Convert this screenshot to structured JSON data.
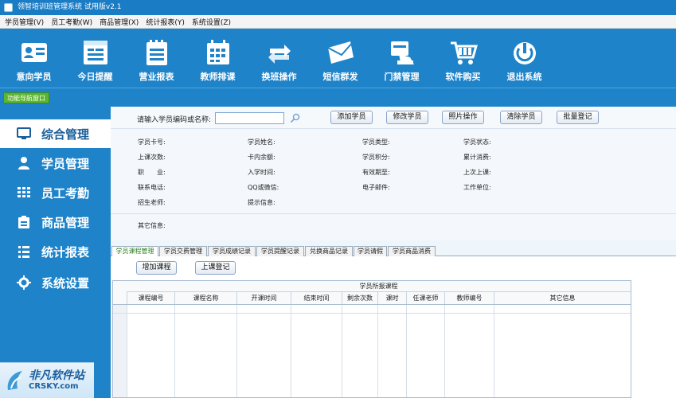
{
  "window": {
    "title": "领智培训班管理系统 试用版v2.1"
  },
  "menu": [
    "学员管理(V)",
    "员工考勤(W)",
    "商品管理(X)",
    "统计报表(Y)",
    "系统设置(Z)"
  ],
  "toolbar": [
    {
      "label": "意向学员",
      "icon": "id-card-icon"
    },
    {
      "label": "今日提醒",
      "icon": "document-icon"
    },
    {
      "label": "营业报表",
      "icon": "report-icon"
    },
    {
      "label": "教师排课",
      "icon": "calendar-icon"
    },
    {
      "label": "换班操作",
      "icon": "swap-arrows-icon"
    },
    {
      "label": "短信群发",
      "icon": "envelope-icon"
    },
    {
      "label": "门禁管理",
      "icon": "card-swipe-icon"
    },
    {
      "label": "软件购买",
      "icon": "cart-icon"
    },
    {
      "label": "退出系统",
      "icon": "power-icon"
    }
  ],
  "nav_window_label": "功能导航窗口",
  "sidebar": [
    {
      "label": "综合管理",
      "icon": "monitor-icon",
      "active": true
    },
    {
      "label": "学员管理",
      "icon": "user-icon"
    },
    {
      "label": "员工考勤",
      "icon": "grid-icon"
    },
    {
      "label": "商品管理",
      "icon": "clipboard-icon"
    },
    {
      "label": "统计报表",
      "icon": "list-icon"
    },
    {
      "label": "系统设置",
      "icon": "gear-icon"
    }
  ],
  "search": {
    "label": "请输入学员编码或名称:",
    "value": ""
  },
  "actions": [
    "添加学员",
    "修改学员",
    "照片操作",
    "清除学员",
    "批量登记"
  ],
  "info_fields": [
    [
      "学员卡号:",
      "学员姓名:",
      "学员类型:",
      "学员状态:"
    ],
    [
      "上课次数:",
      "卡内余额:",
      "学员积分:",
      "累计消费:"
    ],
    [
      "职　　业:",
      "入学时间:",
      "有效期至:",
      "上次上课:"
    ],
    [
      "联系电话:",
      "QQ或微信:",
      "电子邮件:",
      "工作单位:"
    ],
    [
      "招生老师:",
      "提示信息:"
    ]
  ],
  "other_info_label": "其它信息:",
  "tabs": [
    "学员课程管理",
    "学员交费管理",
    "学员成绩记录",
    "学员提醒记录",
    "兑换商品记录",
    "学员请假",
    "学员商品消费"
  ],
  "course_buttons": [
    "增加课程",
    "上课登记"
  ],
  "grid": {
    "group_title": "学员所报课程",
    "columns": [
      "课程编号",
      "课程名称",
      "开课时间",
      "结束时间",
      "剩余次数",
      "课时",
      "任课老师",
      "教师编号",
      "其它信息"
    ]
  },
  "watermark": {
    "line1": "非凡软件站",
    "line2": "CRSKY.com"
  },
  "colors": {
    "primary": "#1e83c9",
    "nav_green": "#5bb530",
    "active_tab_text": "#2a7f1a"
  }
}
